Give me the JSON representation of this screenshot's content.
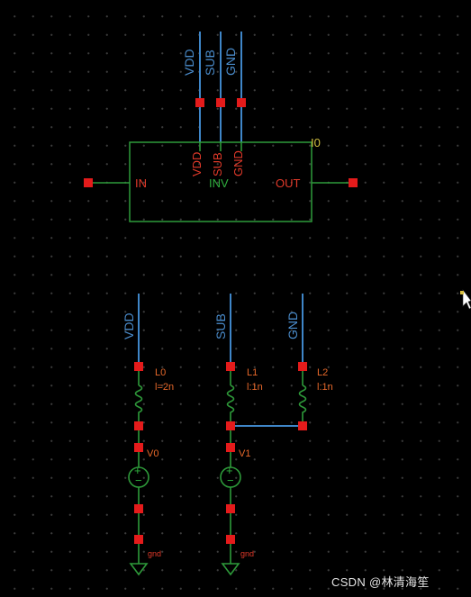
{
  "top_pins": {
    "vdd": "VDD",
    "sub": "SUB",
    "gnd": "GND"
  },
  "symbol": {
    "instance": "I0",
    "in_pin": "IN",
    "out_pin": "OUT",
    "cell_name": "INV",
    "inner_vdd": "VDD",
    "inner_sub": "SUB",
    "inner_gnd": "GND"
  },
  "nets": {
    "vdd": "VDD",
    "sub": "SUB",
    "gnd": "GND"
  },
  "inductors": [
    {
      "name": "L0",
      "value": "l=2n"
    },
    {
      "name": "L1",
      "value": "l:1n"
    },
    {
      "name": "L2",
      "value": "l:1n"
    }
  ],
  "sources": [
    {
      "name": "V0"
    },
    {
      "name": "V1"
    }
  ],
  "grounds": [
    {
      "label": "gnd"
    },
    {
      "label": "gnd"
    }
  ],
  "watermark": "CSDN @林清海笙",
  "colors": {
    "background": "#000000",
    "wire": "#3f86c8",
    "symbol_body": "#2e9a3a",
    "pin": "#e41b1b",
    "instance_label": "#d2c040"
  }
}
